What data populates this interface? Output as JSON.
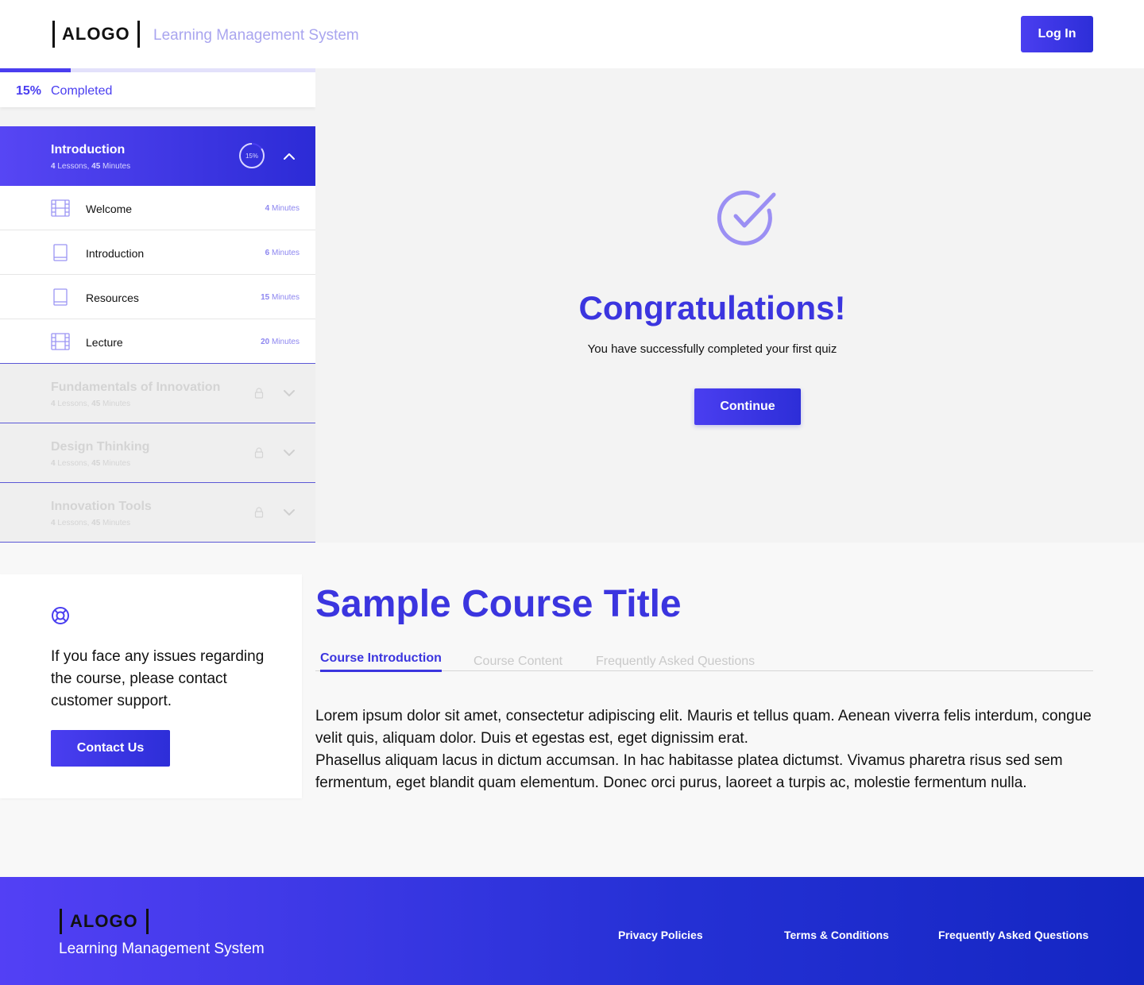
{
  "header": {
    "logo_text": "ALOGO",
    "tagline": "Learning Management System",
    "login_label": "Log In"
  },
  "progress": {
    "percent_label": "15%",
    "completed_label": "Completed",
    "fraction": 0.225
  },
  "modules": [
    {
      "title": "Introduction",
      "lessons_count": "4",
      "lessons_word": " Lessons, ",
      "minutes_count": "45",
      "minutes_word": " Minutes",
      "ring_label": "15%",
      "ring_fraction": 0.15,
      "state": "active",
      "lessons": [
        {
          "icon": "film-icon",
          "name": "Welcome",
          "duration_num": "4",
          "duration_unit": " Minutes"
        },
        {
          "icon": "book-icon",
          "name": "Introduction",
          "duration_num": "6",
          "duration_unit": " Minutes"
        },
        {
          "icon": "book-icon",
          "name": "Resources",
          "duration_num": "15",
          "duration_unit": " Minutes"
        },
        {
          "icon": "film-icon",
          "name": "Lecture",
          "duration_num": "20",
          "duration_unit": " Minutes"
        }
      ]
    },
    {
      "title": "Fundamentals of Innovation",
      "lessons_count": "4",
      "lessons_word": " Lessons, ",
      "minutes_count": "45",
      "minutes_word": " Minutes",
      "state": "locked"
    },
    {
      "title": "Design Thinking",
      "lessons_count": "4",
      "lessons_word": " Lessons, ",
      "minutes_count": "45",
      "minutes_word": " Minutes",
      "state": "locked"
    },
    {
      "title": "Innovation Tools",
      "lessons_count": "4",
      "lessons_word": " Lessons, ",
      "minutes_count": "45",
      "minutes_word": " Minutes",
      "state": "locked"
    }
  ],
  "quiz_result": {
    "heading": "Congratulations!",
    "message": "You have successfully completed your first quiz",
    "continue_label": "Continue"
  },
  "support": {
    "text": "If you face any issues regarding the course, please contact customer support.",
    "contact_label": "Contact Us"
  },
  "course": {
    "title": "Sample Course Title",
    "tabs": [
      "Course Introduction",
      "Course Content",
      "Frequently Asked Questions"
    ],
    "active_tab": 0,
    "paragraph_1": "Lorem ipsum dolor sit amet, consectetur adipiscing elit. Mauris et tellus quam. Aenean viverra felis interdum, congue velit quis, aliquam dolor. Duis et egestas est, eget dignissim erat.",
    "paragraph_2": "Phasellus aliquam lacus in dictum accumsan. In hac habitasse platea dictumst. Vivamus pharetra risus sed sem fermentum, eget blandit quam elementum. Donec orci purus, laoreet a turpis ac, molestie fermentum nulla."
  },
  "footer": {
    "logo_text": "ALOGO",
    "tagline": "Learning Management System",
    "links": [
      "Privacy Policies",
      "Terms & Conditions",
      "Frequently Asked Questions"
    ]
  },
  "colors": {
    "accent": "#3b35df",
    "accent_light": "#a9a5ef",
    "gradient_start": "#5746f4",
    "gradient_end": "#2c2bd6"
  }
}
